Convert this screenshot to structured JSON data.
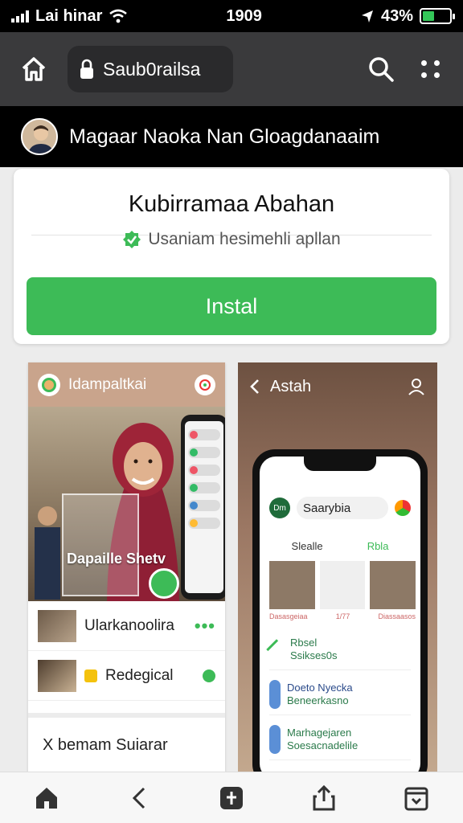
{
  "status_bar": {
    "carrier": "Lai hinar",
    "time": "1909",
    "battery": "43%",
    "battery_level": 0.43,
    "battery_color": "#34c759"
  },
  "browser": {
    "url_text": "Saub0railsa",
    "icons": [
      "home-icon",
      "lock-icon",
      "search-icon",
      "more-icon"
    ]
  },
  "profile": {
    "name": "Magaar Naoka Nan Gloagdanaaim"
  },
  "install_card": {
    "app_title": "Kubirramaa Abahan",
    "verified_text": "Usaniam hesimehli apllan",
    "install_label": "Instal",
    "accent_color": "#3dbb57"
  },
  "screenshot_left": {
    "header_title": "Idampaltkai",
    "hero_caption": "Dapaille Shetv",
    "rows": [
      {
        "label": "Ularkanoolira",
        "action": "•••"
      },
      {
        "label": "Redegical"
      }
    ],
    "bottom_label": "X bemam Suiarar"
  },
  "screenshot_right": {
    "header_title": "Astah",
    "phone": {
      "logo": "Dm",
      "search": "Saarybia",
      "tabs": [
        "Slealle",
        "Rbla"
      ],
      "captions": [
        "Dasasgeiaa",
        "1/77",
        "Diassaasos"
      ],
      "items": [
        {
          "title": "Rbsel",
          "subtitle": "Ssikses0s"
        },
        {
          "title": "Doeto Nyecka",
          "subtitle": "Beneerkasno"
        },
        {
          "title": "Marhagejaren",
          "subtitle": "Soesacnadelile"
        }
      ]
    }
  },
  "bottom_nav": {
    "items": [
      "home-icon",
      "back-icon",
      "tabs-icon",
      "share-icon",
      "downloads-icon"
    ]
  }
}
